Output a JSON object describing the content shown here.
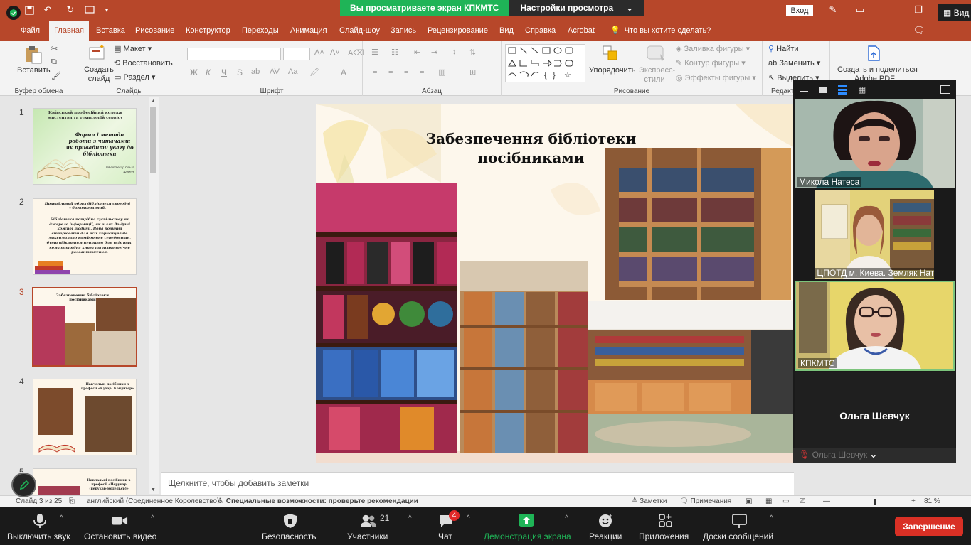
{
  "titlebar": {
    "share_notice": "Вы просматриваете экран КПКМТС",
    "view_settings": "Настройки просмотра",
    "login": "Вход",
    "view_label": "Вид"
  },
  "menu": {
    "tabs": [
      "Файл",
      "Главная",
      "Вставка",
      "Рисование",
      "Конструктор",
      "Переходы",
      "Анимация",
      "Слайд-шоу",
      "Запись",
      "Рецензирование",
      "Вид",
      "Справка",
      "Acrobat"
    ],
    "active_index": 1,
    "tell_me": "Что вы хотите сделать?"
  },
  "ribbon": {
    "clipboard": {
      "paste": "Вставить",
      "group": "Буфер обмена"
    },
    "slides": {
      "new_slide": "Создать слайд",
      "layout": "Макет",
      "reset": "Восстановить",
      "section": "Раздел",
      "group": "Слайды"
    },
    "font": {
      "group": "Шрифт",
      "bold": "Ж",
      "italic": "К",
      "underline": "Ч",
      "strike": "S",
      "font_color": "A"
    },
    "paragraph": {
      "group": "Абзац"
    },
    "drawing": {
      "arrange": "Упорядочить",
      "quick_styles": "Экспресс-стили",
      "fill": "Заливка фигуры",
      "outline": "Контур фигуры",
      "effects": "Эффекты фигуры",
      "group": "Рисование"
    },
    "editing": {
      "find": "Найти",
      "replace": "Заменить",
      "select": "Выделить",
      "group": "Редакт"
    },
    "adobe": {
      "label1": "Создать и поделиться",
      "label2": "Adobe PDF"
    }
  },
  "thumbnails": [
    {
      "num": "1",
      "title": "Київський професійний коледж мистецтва та технологій сервісу",
      "subtitle": "Форми і методи роботи з читачами: як привабити увагу до бібліотеки",
      "author": "Бібліотекар Ольга Шевчук"
    },
    {
      "num": "2",
      "title": "Привабливий образ бібліотеки сьогодні – багатогранний.",
      "body": "Бібліотека потрібна суспільству як джерело інформації, як шлях до душі кожної людини. Вона повинна створювати для всіх користувачів максимально комфортне середовище, бути відкритим центром для всіх тих, кому потрібна книга та психологічне розвантаження."
    },
    {
      "num": "3",
      "title": "Забезпечення бібліотеки посібниками"
    },
    {
      "num": "4",
      "title": "Навчальні посібники з професії «Кухар. Кондитер»"
    },
    {
      "num": "5",
      "title": "Навчальні посібники з професії «Перукар (перукар-модельєр)»"
    }
  ],
  "selected_slide": 3,
  "slide": {
    "title_line1": "Забезпечення бібліотеки",
    "title_line2": "посібниками"
  },
  "notes": {
    "placeholder": "Щелкните, чтобы добавить заметки"
  },
  "status": {
    "slide_of": "Слайд 3 из 25",
    "language": "английский (Соединенное Королевство)",
    "accessibility": "Специальные возможности: проверьте рекомендации",
    "notes": "Заметки",
    "comments": "Примечания",
    "zoom": "81 %",
    "zoom_fraction": 0.55
  },
  "video": {
    "participants": [
      {
        "name": "Микола Натеса"
      },
      {
        "name": "ДНЗ ЦПОТД м. Киева. Земляк Нат..."
      },
      {
        "name": "КПКМТС"
      },
      {
        "name": "Ольга Шевчук"
      }
    ],
    "bottom_name": "Ольга Шевчук"
  },
  "zoom": {
    "mute": "Выключить звук",
    "video": "Остановить видео",
    "security": "Безопасность",
    "participants": "Участники",
    "participants_count": "21",
    "chat": "Чат",
    "chat_badge": "4",
    "share": "Демонстрация экрана",
    "reactions": "Реакции",
    "apps": "Приложения",
    "whiteboards": "Доски сообщений",
    "end": "Завершение"
  },
  "colors": {
    "ppt_accent": "#b7472a",
    "zoom_green": "#1fb457",
    "end_red": "#d93025"
  }
}
